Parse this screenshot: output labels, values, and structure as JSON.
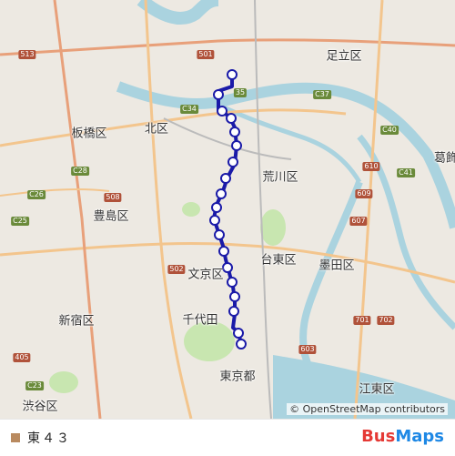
{
  "map": {
    "place_labels": [
      {
        "id": "adachi",
        "text": "足立区"
      },
      {
        "id": "itabashi",
        "text": "板橋区"
      },
      {
        "id": "kita",
        "text": "北区"
      },
      {
        "id": "katsushika",
        "text": "葛飾"
      },
      {
        "id": "arakawa",
        "text": "荒川区"
      },
      {
        "id": "toshima",
        "text": "豊島区"
      },
      {
        "id": "taito",
        "text": "台東区"
      },
      {
        "id": "bunkyo",
        "text": "文京区"
      },
      {
        "id": "sumida",
        "text": "墨田区"
      },
      {
        "id": "shinjuku",
        "text": "新宿区"
      },
      {
        "id": "chiyoda",
        "text": "千代田"
      },
      {
        "id": "tokyo",
        "text": "東京都"
      },
      {
        "id": "koto",
        "text": "江東区"
      },
      {
        "id": "shibuya",
        "text": "渋谷区"
      }
    ],
    "road_shields": [
      {
        "id": "c35",
        "text": "35"
      },
      {
        "id": "c34",
        "text": "C34"
      },
      {
        "id": "c37",
        "text": "C37"
      },
      {
        "id": "c40",
        "text": "C40"
      },
      {
        "id": "c41",
        "text": "C41"
      },
      {
        "id": "c28",
        "text": "C28"
      },
      {
        "id": "c26",
        "text": "C26"
      },
      {
        "id": "c25",
        "text": "C25"
      },
      {
        "id": "c23",
        "text": "C23"
      },
      {
        "id": "r513",
        "text": "513"
      },
      {
        "id": "r501",
        "text": "501"
      },
      {
        "id": "r508",
        "text": "508"
      },
      {
        "id": "r502",
        "text": "502"
      },
      {
        "id": "r609",
        "text": "609"
      },
      {
        "id": "r607",
        "text": "607"
      },
      {
        "id": "r610",
        "text": "610"
      },
      {
        "id": "r405",
        "text": "405"
      },
      {
        "id": "r701",
        "text": "701"
      },
      {
        "id": "r702",
        "text": "702"
      },
      {
        "id": "r603",
        "text": "603"
      }
    ],
    "attribution": "© OpenStreetMap contributors",
    "route_color": "#1a1aa8",
    "water_color": "#aad3df",
    "park_color": "#c8e6b0"
  },
  "legend": {
    "route_name": "東４３",
    "swatch_color": "#b98a5f"
  },
  "brand": {
    "part1": "Bus",
    "part2": "Maps"
  }
}
